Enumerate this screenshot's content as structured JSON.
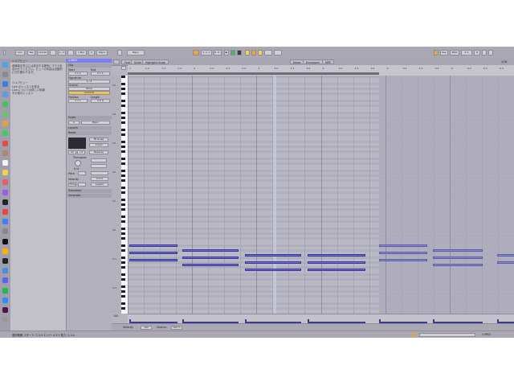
{
  "topbar": {
    "link_label": "Link",
    "tap_label": "Tap",
    "tempo": "120.00",
    "time_sig": "4 / 4",
    "metronome": "1 Bar",
    "key": "C",
    "scale": "Major",
    "position": "1. 1. 1",
    "loop_end": "4. 0. 0",
    "key_label": "Key",
    "midi_label": "MIDI",
    "cpu": "3 %",
    "d_label": "D"
  },
  "dock": {
    "icons": [
      "finder",
      "launchpad",
      "safari",
      "mail",
      "messages",
      "maps",
      "photos",
      "facetime",
      "calendar",
      "contacts",
      "reminders",
      "notes",
      "music",
      "podcasts",
      "tv",
      "news",
      "appstore",
      "settings",
      "live",
      "chrome",
      "terminal",
      "preview",
      "discord",
      "spotify",
      "zoom",
      "slack",
      "trash"
    ]
  },
  "help": {
    "title": "ヘルプビュー",
    "body": "各機能を学ぶには該当する箇所にマウスを合わせてください。ビューの内容は自動的に切り替わります。",
    "section_title": "ヘルプビュー",
    "bullets": [
      "Live のレッスンを見る",
      "Live についての詳しい情報",
      "その他のレッスン"
    ]
  },
  "clip": {
    "name": "1-MIDI",
    "clip_head": "Clip",
    "start_label": "Start",
    "end_label": "End",
    "start_val": "1 1 1",
    "end_val": "5 1 1",
    "signature_label": "Signature",
    "signature_val": "4 / 4",
    "groove_label": "Groove",
    "groove_val": "None",
    "commit_label": "Commit",
    "loop_label": "Loop",
    "position_label": "Position",
    "length_label": "Length",
    "position_val": "1 1 1",
    "length_val": "4 0 0",
    "scale_head": "Scale",
    "scale_key": "C",
    "scale_name": "Major",
    "launch_head": "Launch",
    "notes_head": "Notes",
    "transpose_label": "Transpose",
    "transpose_val": "0 st",
    "velocity_label": "Velocity",
    "velocity_val": "0.0 %",
    "pitch_label": "Pitch",
    "time_label": "Time",
    "fit_label": "Fit Scale",
    "invert_label": "Invert",
    "double_label": "x2",
    "half_label": "÷2",
    "reverse_label": "Reverse",
    "legato_label": "Legato",
    "transform_head": "Transform",
    "generate_head": "Generate"
  },
  "editor": {
    "tabs": [
      "Fold",
      "Scale"
    ],
    "highlight": "Highlight Scale",
    "view_tabs": [
      "Notes",
      "Envelopes",
      "MPE"
    ],
    "zoom": "1/16",
    "ruler": [
      "1",
      "1.2",
      "1.3",
      "1.4",
      "2",
      "2.2",
      "2.3",
      "2.4",
      "3",
      "3.2",
      "3.3",
      "3.4",
      "4",
      "4.2",
      "4.3",
      "4.4",
      "5",
      "5.2",
      "5.3",
      "5.4",
      "6",
      "6.2",
      "6.3",
      "6.4"
    ],
    "octaves": [
      "C5",
      "C4",
      "C3",
      "C2",
      "C1",
      "C0",
      "C-1",
      "C-2"
    ],
    "velocity_value": "100",
    "foot_labels": [
      "Velocity",
      "Chance"
    ],
    "foot_vals": [
      "100",
      "100 %"
    ]
  },
  "status": {
    "left": "選択範囲 スタート: 2.3.3 エンド: 4.3.3 長さ: 2.1.0",
    "track": "1-MIDI"
  }
}
